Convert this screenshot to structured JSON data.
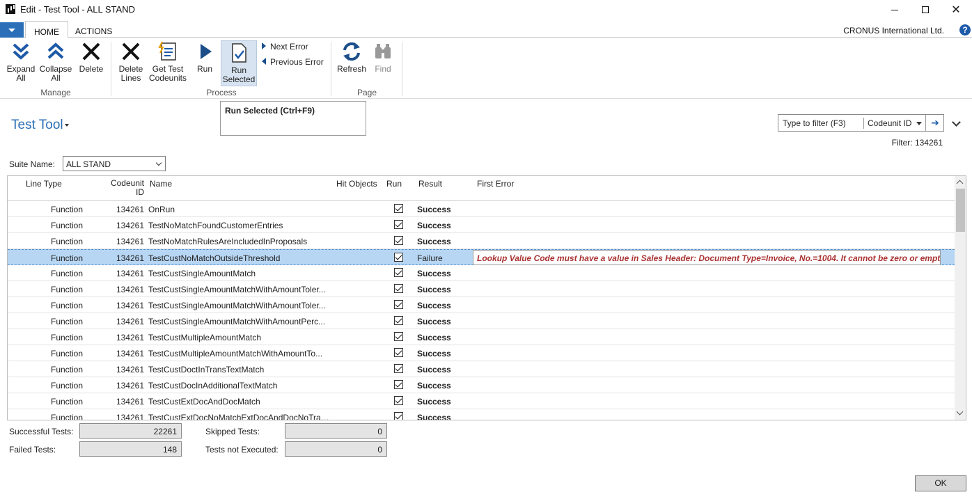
{
  "window": {
    "title": "Edit - Test Tool - ALL STAND"
  },
  "ribbon_tabs": [
    {
      "label": "HOME"
    },
    {
      "label": "ACTIONS"
    }
  ],
  "company": "CRONUS International Ltd.",
  "help": "?",
  "ribbon": {
    "manage": {
      "label": "Manage",
      "expand_all": "Expand All",
      "collapse_all": "Collapse All",
      "delete": "Delete"
    },
    "process": {
      "label": "Process",
      "delete_lines": "Delete Lines",
      "get_test_codeunits": "Get Test Codeunits",
      "run": "Run",
      "run_selected": "Run Selected",
      "next_error": "Next Error",
      "previous_error": "Previous Error"
    },
    "page": {
      "label": "Page",
      "refresh": "Refresh",
      "find": "Find"
    }
  },
  "tooltip": "Run Selected (Ctrl+F9)",
  "page_title": "Test Tool",
  "filter": {
    "placeholder": "Type to filter (F3)",
    "field": "Codeunit ID",
    "status": "Filter: 134261"
  },
  "suite": {
    "label": "Suite Name:",
    "value": "ALL STAND"
  },
  "columns": {
    "line_type": "Line Type",
    "codeunit_id_1": "Codeunit",
    "codeunit_id_2": "ID",
    "name": "Name",
    "hit_objects": "Hit Objects",
    "run": "Run",
    "result": "Result",
    "first_error": "First Error"
  },
  "rows": [
    {
      "type": "Function",
      "id": "134261",
      "name": "OnRun",
      "result": "Success"
    },
    {
      "type": "Function",
      "id": "134261",
      "name": "TestNoMatchFoundCustomerEntries",
      "result": "Success"
    },
    {
      "type": "Function",
      "id": "134261",
      "name": "TestNoMatchRulesAreIncludedInProposals",
      "result": "Success"
    },
    {
      "type": "Function",
      "id": "134261",
      "name": "TestCustNoMatchOutsideThreshold",
      "result": "Failure",
      "error": "Lookup Value Code must have a value in Sales Header: Document Type=Invoice, No.=1004. It cannot be zero or empty."
    },
    {
      "type": "Function",
      "id": "134261",
      "name": "TestCustSingleAmountMatch",
      "result": "Success"
    },
    {
      "type": "Function",
      "id": "134261",
      "name": "TestCustSingleAmountMatchWithAmountToler...",
      "result": "Success"
    },
    {
      "type": "Function",
      "id": "134261",
      "name": "TestCustSingleAmountMatchWithAmountToler...",
      "result": "Success"
    },
    {
      "type": "Function",
      "id": "134261",
      "name": "TestCustSingleAmountMatchWithAmountPerc...",
      "result": "Success"
    },
    {
      "type": "Function",
      "id": "134261",
      "name": "TestCustMultipleAmountMatch",
      "result": "Success"
    },
    {
      "type": "Function",
      "id": "134261",
      "name": "TestCustMultipleAmountMatchWithAmountTo...",
      "result": "Success"
    },
    {
      "type": "Function",
      "id": "134261",
      "name": "TestCustDoctInTransTextMatch",
      "result": "Success"
    },
    {
      "type": "Function",
      "id": "134261",
      "name": "TestCustDocInAdditionalTextMatch",
      "result": "Success"
    },
    {
      "type": "Function",
      "id": "134261",
      "name": "TestCustExtDocAndDocMatch",
      "result": "Success"
    },
    {
      "type": "Function",
      "id": "134261",
      "name": "TestCustExtDocNoMatchExtDocAndDocNoTrailingChar",
      "result": "Success"
    }
  ],
  "summary": {
    "successful_label": "Successful Tests:",
    "successful_value": "22261",
    "failed_label": "Failed Tests:",
    "failed_value": "148",
    "skipped_label": "Skipped Tests:",
    "skipped_value": "0",
    "not_executed_label": "Tests not Executed:",
    "not_executed_value": "0"
  },
  "ok": "OK"
}
